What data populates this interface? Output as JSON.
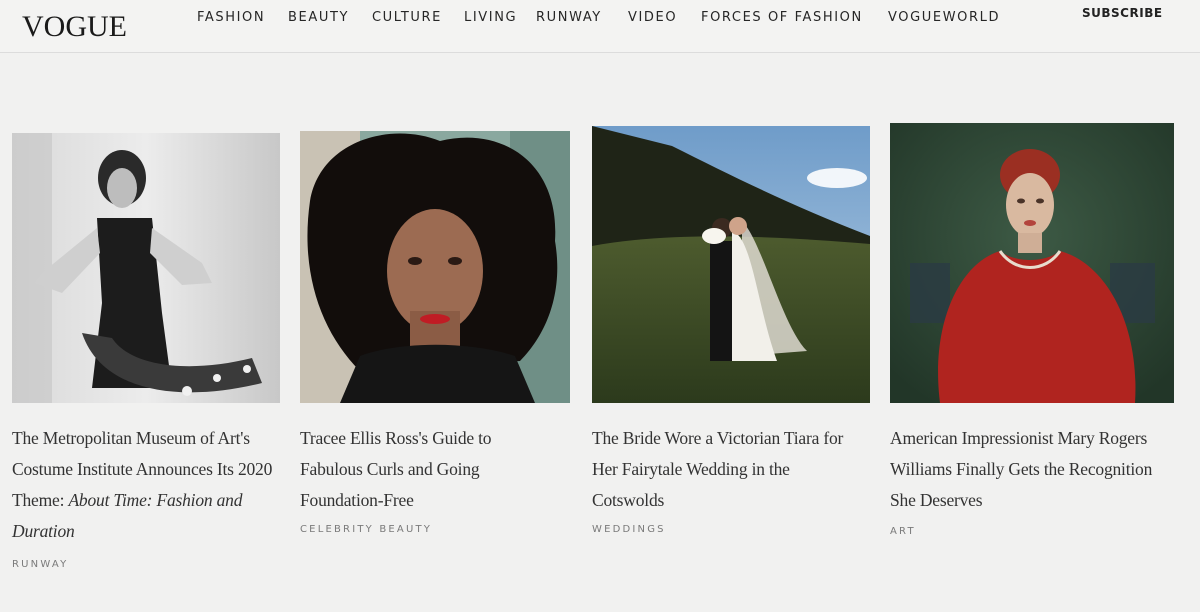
{
  "header": {
    "logo": "VOGUE",
    "nav": [
      "FASHION",
      "BEAUTY",
      "CULTURE",
      "LIVING",
      "RUNWAY",
      "VIDEO",
      "FORCES OF FASHION",
      "VOGUEWORLD"
    ],
    "subscribe": "SUBSCRIBE"
  },
  "cards": [
    {
      "title": "The Metropolitan Museum of Art's Costume Institute Announces Its 2020 Theme: ",
      "title_italic": "About Time: Fashion and Duration",
      "category": "RUNWAY"
    },
    {
      "title": "Tracee Ellis Ross's Guide to Fabulous Curls and Going Foundation-Free",
      "title_italic": "",
      "category": "CELEBRITY BEAUTY"
    },
    {
      "title": "The Bride Wore a Victorian Tiara for Her Fairytale Wedding in the Cotswolds",
      "title_italic": "",
      "category": "WEDDINGS"
    },
    {
      "title": "American Impressionist Mary Rogers Williams Finally Gets the Recognition She Deserves",
      "title_italic": "",
      "category": "ART"
    }
  ]
}
